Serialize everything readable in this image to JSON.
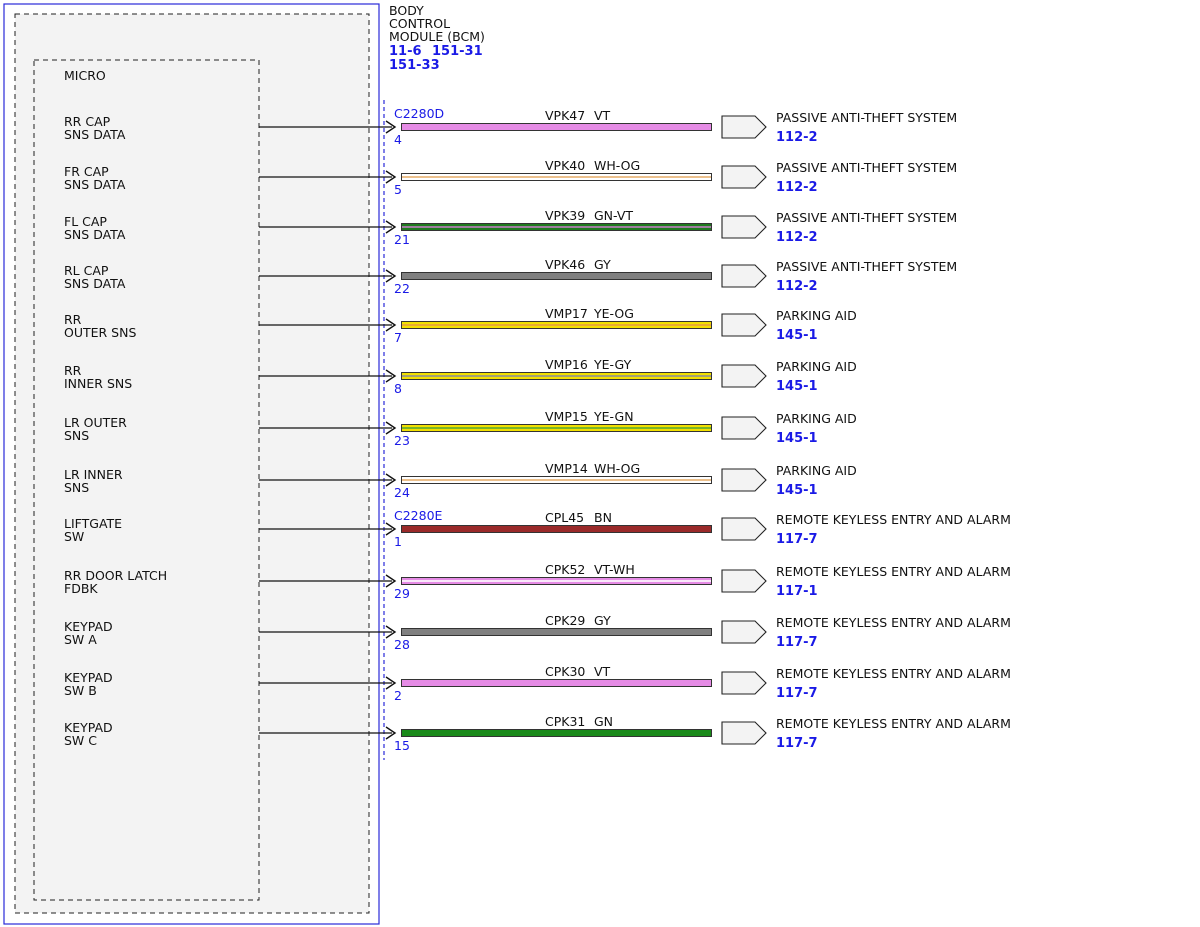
{
  "module": {
    "title_lines": [
      "BODY",
      "CONTROL",
      "MODULE (BCM)"
    ],
    "refs_line1": [
      "11-6",
      "151-31"
    ],
    "refs_line2": [
      "151-33"
    ],
    "inner_label": "MICRO"
  },
  "connectors": [
    {
      "name": "C2280D",
      "row": 0
    },
    {
      "name": "C2280E",
      "row": 8
    }
  ],
  "circuits": [
    {
      "signal": [
        "RR CAP",
        "SNS DATA"
      ],
      "pin": "4",
      "circuit": "VPK47",
      "color_code": "VT",
      "colors": [
        "#e58be5",
        "#e58be5"
      ],
      "dest": "PASSIVE ANTI-THEFT SYSTEM",
      "ref": "112-2"
    },
    {
      "signal": [
        "FR CAP",
        "SNS DATA"
      ],
      "pin": "5",
      "circuit": "VPK40",
      "color_code": "WH-OG",
      "colors": [
        "#ffffff",
        "#e8b070"
      ],
      "dest": "PASSIVE ANTI-THEFT SYSTEM",
      "ref": "112-2"
    },
    {
      "signal": [
        "FL CAP",
        "SNS DATA"
      ],
      "pin": "21",
      "circuit": "VPK39",
      "color_code": "GN-VT",
      "colors": [
        "#1f7a1f",
        "#c080c0"
      ],
      "dest": "PASSIVE ANTI-THEFT SYSTEM",
      "ref": "112-2"
    },
    {
      "signal": [
        "RL CAP",
        "SNS DATA"
      ],
      "pin": "22",
      "circuit": "VPK46",
      "color_code": "GY",
      "colors": [
        "#808080",
        "#808080"
      ],
      "dest": "PASSIVE ANTI-THEFT SYSTEM",
      "ref": "112-2"
    },
    {
      "signal": [
        "RR",
        "OUTER SNS"
      ],
      "pin": "7",
      "circuit": "VMP17",
      "color_code": "YE-OG",
      "colors": [
        "#f2e000",
        "#e8a040"
      ],
      "dest": "PARKING AID",
      "ref": "145-1"
    },
    {
      "signal": [
        "RR",
        "INNER SNS"
      ],
      "pin": "8",
      "circuit": "VMP16",
      "color_code": "YE-GY",
      "colors": [
        "#f2e000",
        "#909090"
      ],
      "dest": "PARKING AID",
      "ref": "145-1"
    },
    {
      "signal": [
        "LR OUTER",
        "SNS"
      ],
      "pin": "23",
      "circuit": "VMP15",
      "color_code": "YE-GN",
      "colors": [
        "#f2e000",
        "#5aaa30"
      ],
      "dest": "PARKING AID",
      "ref": "145-1"
    },
    {
      "signal": [
        "LR INNER",
        "SNS"
      ],
      "pin": "24",
      "circuit": "VMP14",
      "color_code": "WH-OG",
      "colors": [
        "#ffffff",
        "#e8b070"
      ],
      "dest": "PARKING AID",
      "ref": "145-1"
    },
    {
      "signal": [
        "LIFTGATE",
        "SW"
      ],
      "pin": "1",
      "circuit": "CPL45",
      "color_code": "BN",
      "colors": [
        "#9a2a2a",
        "#9a2a2a"
      ],
      "dest": "REMOTE KEYLESS ENTRY AND ALARM",
      "ref": "117-7"
    },
    {
      "signal": [
        "RR DOOR LATCH",
        "FDBK"
      ],
      "pin": "29",
      "circuit": "CPK52",
      "color_code": "VT-WH",
      "colors": [
        "#e58be5",
        "#ffffff"
      ],
      "dest": "REMOTE KEYLESS ENTRY AND ALARM",
      "ref": "117-1"
    },
    {
      "signal": [
        "KEYPAD",
        "SW A"
      ],
      "pin": "28",
      "circuit": "CPK29",
      "color_code": "GY",
      "colors": [
        "#808080",
        "#808080"
      ],
      "dest": "REMOTE KEYLESS ENTRY AND ALARM",
      "ref": "117-7"
    },
    {
      "signal": [
        "KEYPAD",
        "SW B"
      ],
      "pin": "2",
      "circuit": "CPK30",
      "color_code": "VT",
      "colors": [
        "#e58be5",
        "#e58be5"
      ],
      "dest": "REMOTE KEYLESS ENTRY AND ALARM",
      "ref": "117-7"
    },
    {
      "signal": [
        "KEYPAD",
        "SW C"
      ],
      "pin": "15",
      "circuit": "CPK31",
      "color_code": "GN",
      "colors": [
        "#1a8a1a",
        "#1a8a1a"
      ],
      "dest": "REMOTE KEYLESS ENTRY AND ALARM",
      "ref": "117-7"
    }
  ]
}
